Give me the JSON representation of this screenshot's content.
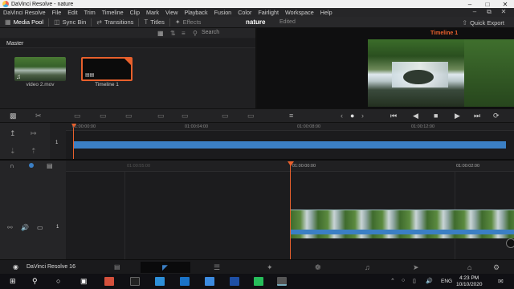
{
  "window": {
    "title": "DaVinci Resolve - nature"
  },
  "menu": [
    "DaVinci Resolve",
    "File",
    "Edit",
    "Trim",
    "Timeline",
    "Clip",
    "Mark",
    "View",
    "Playback",
    "Fusion",
    "Color",
    "Fairlight",
    "Workspace",
    "Help"
  ],
  "toolbar": {
    "media_pool": "Media Pool",
    "sync_bin": "Sync Bin",
    "transitions": "Transitions",
    "titles": "Titles",
    "effects": "Effects",
    "timeline_name": "nature",
    "edited": "Edited",
    "quick_export": "Quick Export",
    "search_label": "Search"
  },
  "media_pool": {
    "bin": "Master",
    "clips": [
      {
        "name": "video 2.mov",
        "selected": false
      },
      {
        "name": "Timeline 1",
        "selected": true
      }
    ]
  },
  "viewer": {
    "title": "Timeline 1"
  },
  "upper_timeline": {
    "track_number": "1",
    "ruler": [
      "01:00:00:00",
      "01:00:04:00",
      "01:00:08:00",
      "01:00:12:00"
    ]
  },
  "lower_timeline": {
    "track_number": "1",
    "ruler": [
      "01:00:55:00",
      "01:00:00:00",
      "01:00:02:00"
    ]
  },
  "page_bar": {
    "app_name": "DaVinci Resolve 16"
  },
  "taskbar": {
    "language": "ENG",
    "time": "4:23 PM",
    "date": "10/10/2020"
  },
  "colors": {
    "accent": "#e8602c",
    "clip_blue": "#3b7fc4",
    "playhead": "#e8602c"
  }
}
